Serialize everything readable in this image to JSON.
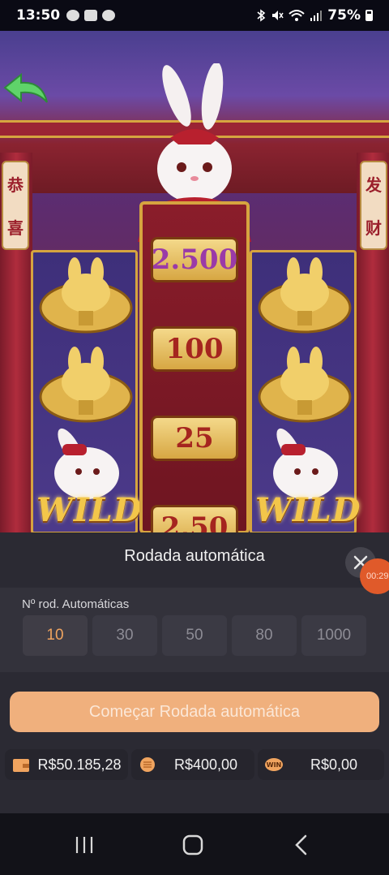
{
  "status_bar": {
    "time": "13:50",
    "battery_percent": "75%",
    "icons_left": [
      "face-icon",
      "photo-icon",
      "person-icon"
    ],
    "icons_right": [
      "bluetooth-icon",
      "mute-icon",
      "wifi-icon",
      "signal-icon",
      "battery-icon"
    ]
  },
  "game": {
    "banner_left": [
      "恭",
      "喜"
    ],
    "banner_right": [
      "发",
      "财"
    ],
    "center_values": [
      "2.500",
      "100",
      "25",
      "2,50"
    ],
    "wild_label": "WILD",
    "colors": {
      "gold": "#d6a43f",
      "red": "#8a1d2a"
    }
  },
  "autoplay_panel": {
    "title": "Rodada automática",
    "timer_badge": "00:29",
    "rounds_label": "Nº rod. Automáticas",
    "options": [
      "10",
      "30",
      "50",
      "80",
      "1000"
    ],
    "selected_option": "10",
    "start_label": "Começar Rodada automática",
    "colors": {
      "accent": "#f0a45f",
      "start_button": "#f0b07d"
    }
  },
  "balances": {
    "wallet": "R$50.185,28",
    "bet": "R$400,00",
    "win": "R$0,00",
    "icons": [
      "wallet-icon",
      "coins-icon",
      "win-icon"
    ]
  },
  "nav": {
    "icons": [
      "recent-apps-icon",
      "home-icon",
      "back-icon"
    ]
  }
}
